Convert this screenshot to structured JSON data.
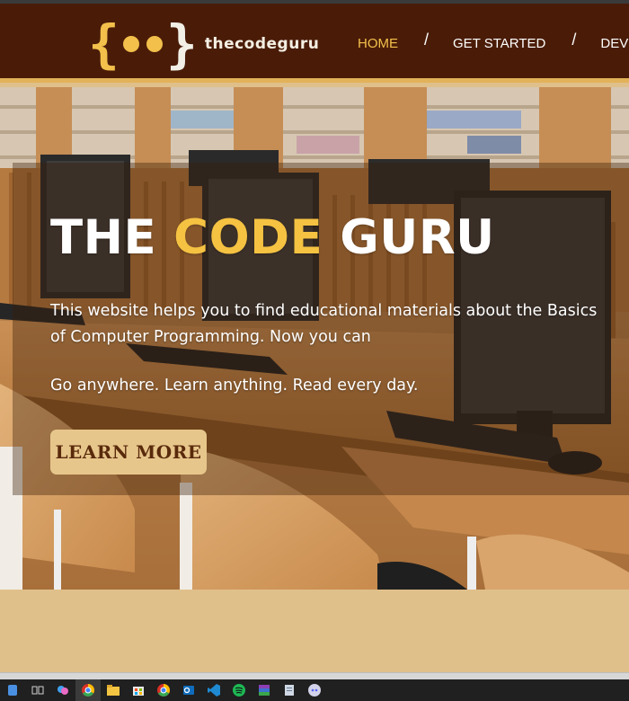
{
  "brand": {
    "logo_text": "thecodeguru",
    "brace_left": "{",
    "brace_right": "}"
  },
  "nav": {
    "items": [
      {
        "label": "HOME",
        "active": true
      },
      {
        "label": "GET STARTED",
        "active": false
      },
      {
        "label": "DEV",
        "active": false
      }
    ],
    "separator": "/"
  },
  "hero": {
    "title_part1": "THE",
    "title_accent": "CODE",
    "title_part2": "GURU",
    "description": "This website helps you to find educational materials about the Basics of Computer Programming. Now you can",
    "tagline": "Go anywhere. Learn anything. Read every day.",
    "cta_label": "LEARN MORE"
  },
  "taskbar": {
    "icons": [
      "app-icon",
      "task-view-icon",
      "copilot-icon",
      "chrome-icon",
      "file-explorer-icon",
      "store-icon",
      "chrome-icon",
      "outlook-icon",
      "vscode-icon",
      "spotify-icon",
      "winrar-icon",
      "notes-icon",
      "discord-icon"
    ]
  },
  "colors": {
    "nav_bg": "#4a1c08",
    "accent": "#f5c242",
    "button_bg": "#e7c68b",
    "page_bg": "#e0c08a"
  }
}
